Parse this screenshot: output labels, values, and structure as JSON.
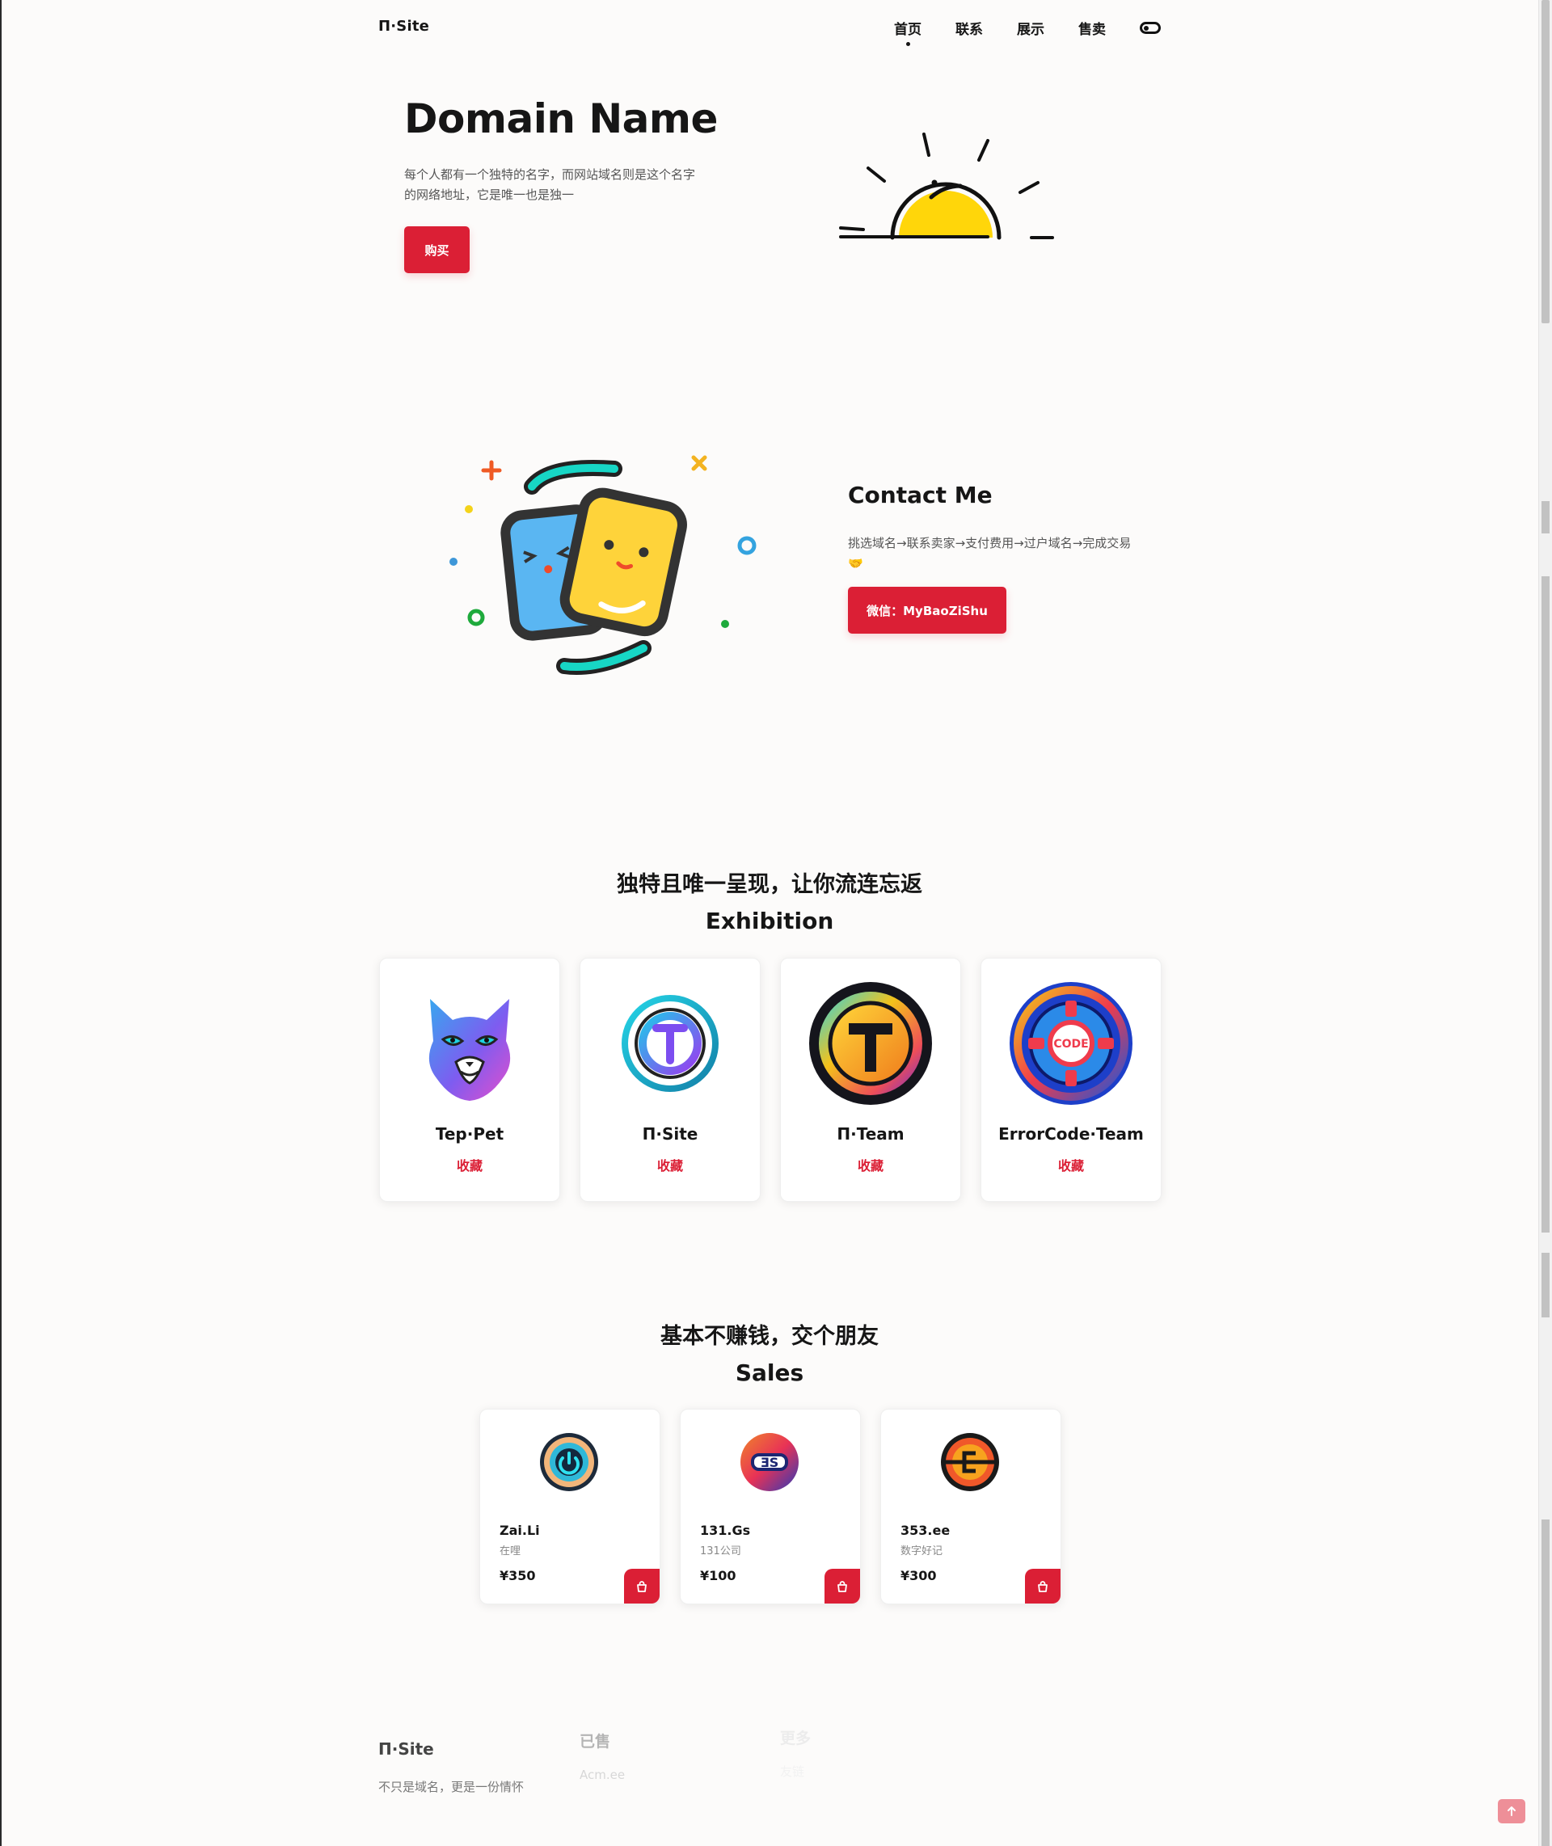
{
  "colors": {
    "accent": "#db1f35",
    "background": "#fcfbfa",
    "text": "#161616"
  },
  "header": {
    "logo": "Π·Site",
    "nav": [
      "首页",
      "联系",
      "展示",
      "售卖"
    ],
    "active_nav": "首页",
    "theme_toggle_icon": "theme-toggle-icon"
  },
  "hero": {
    "title": "Domain Name",
    "description": "每个人都有一个独特的名字，而网站域名则是这个名字的网络地址，它是唯一也是独一",
    "buy_label": "购买",
    "illustration": "sunrise-illustration"
  },
  "contact": {
    "title": "Contact Me",
    "description": "挑选域名→联系卖家→支付费用→过户域名→完成交易🤝",
    "wechat_label": "微信：MyBaoZiShu",
    "illustration": "two-friends-illustration"
  },
  "exhibition": {
    "heading_cn": "独特且唯一呈现，让你流连忘返",
    "heading_en": "Exhibition",
    "items": [
      {
        "name": "Tep·Pet",
        "action": "收藏",
        "icon": "cat-logo-icon"
      },
      {
        "name": "Π·Site",
        "action": "收藏",
        "icon": "ring-t-logo-icon"
      },
      {
        "name": "Π·Team",
        "action": "收藏",
        "icon": "gold-t-logo-icon"
      },
      {
        "name": "ErrorCode·Team",
        "action": "收藏",
        "icon": "code-gear-logo-icon"
      }
    ]
  },
  "sales": {
    "heading_cn": "基本不赚钱，交个朋友",
    "heading_en": "Sales",
    "items": [
      {
        "name": "Zai.Li",
        "desc": "在哩",
        "price": "¥350",
        "icon": "power-logo-icon"
      },
      {
        "name": "131.Gs",
        "desc": "131公司",
        "price": "¥100",
        "icon": "gs-logo-icon"
      },
      {
        "name": "353.ee",
        "desc": "数字好记",
        "price": "¥300",
        "icon": "e-logo-icon"
      }
    ]
  },
  "footer": {
    "logo": "Π·Site",
    "slogan": "不只是域名，更是一份情怀",
    "sold_title": "已售",
    "sold_items": [
      "Acm.ee"
    ],
    "third_title": "更多",
    "third_items": [
      "友链"
    ]
  }
}
